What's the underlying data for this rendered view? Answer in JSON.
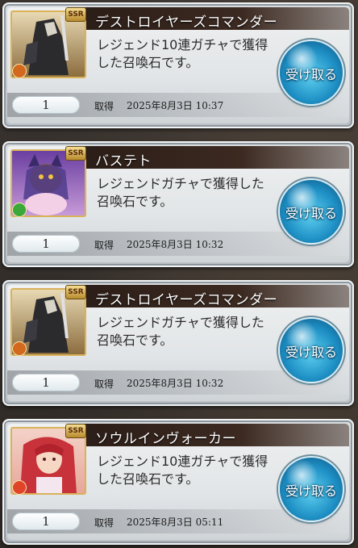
{
  "screen": {
    "acquired_label": "取得",
    "receive_label": "受け取る"
  },
  "items": [
    {
      "name": "デストロイヤーズコマンダー",
      "description": "レジェンド10連ガチャで獲得した召喚石です。",
      "count": "1",
      "date": "2025年8月3日 10:37",
      "rarity": "SSR",
      "element_color": "#d2691e",
      "portrait": "dark-knight"
    },
    {
      "name": "バステト",
      "description": "レジェンドガチャで獲得した召喚石です。",
      "count": "1",
      "date": "2025年8月3日 10:32",
      "rarity": "SSR",
      "element_color": "#3aa83a",
      "portrait": "cat-goddess"
    },
    {
      "name": "デストロイヤーズコマンダー",
      "description": "レジェンドガチャで獲得した召喚石です。",
      "count": "1",
      "date": "2025年8月3日 10:32",
      "rarity": "SSR",
      "element_color": "#d2691e",
      "portrait": "dark-knight"
    },
    {
      "name": "ソウルインヴォーカー",
      "description": "レジェンド10連ガチャで獲得した召喚石です。",
      "count": "1",
      "date": "2025年8月3日 05:11",
      "rarity": "SSR",
      "element_color": "#e0452a",
      "portrait": "red-hair-girl"
    }
  ]
}
